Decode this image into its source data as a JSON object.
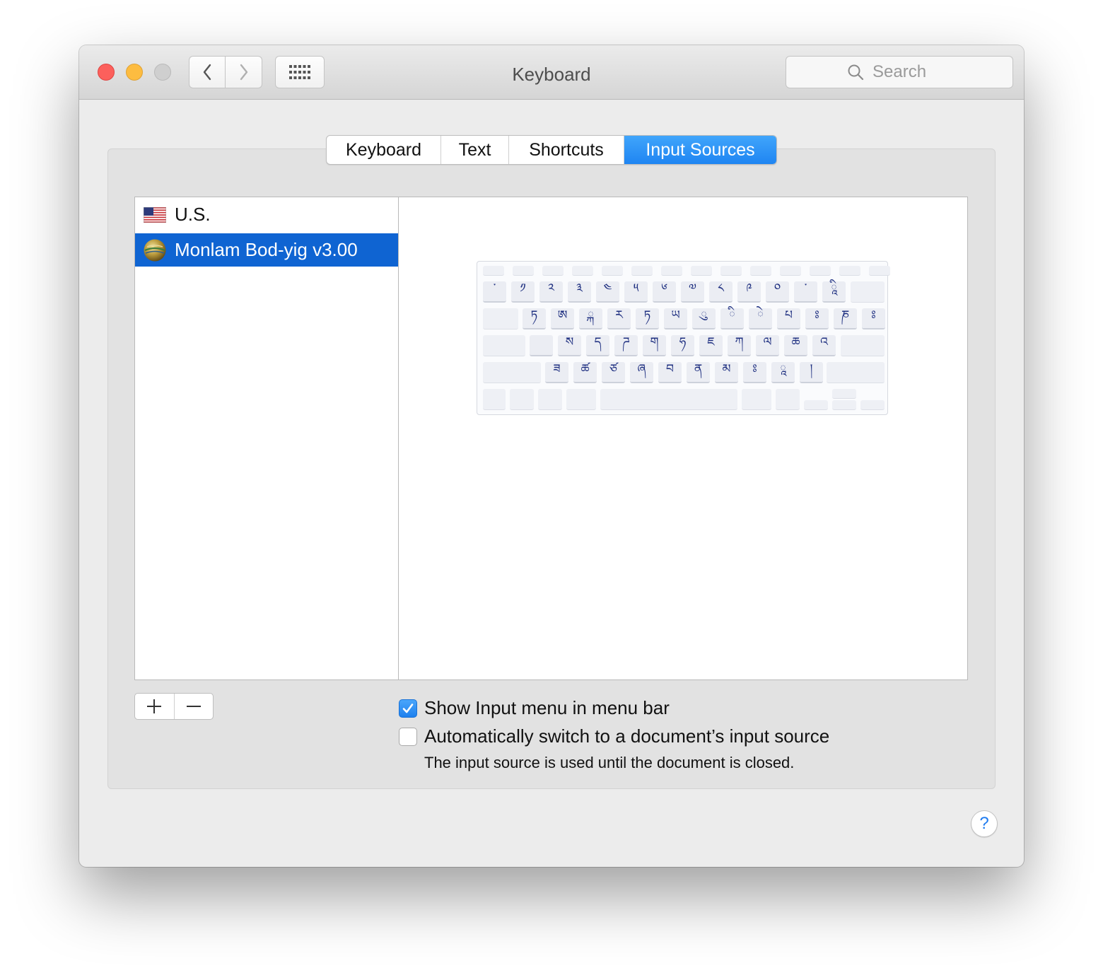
{
  "window": {
    "title": "Keyboard"
  },
  "search": {
    "placeholder": "Search"
  },
  "tabs": [
    {
      "label": "Keyboard",
      "active": false
    },
    {
      "label": "Text",
      "active": false
    },
    {
      "label": "Shortcuts",
      "active": false
    },
    {
      "label": "Input Sources",
      "active": true
    }
  ],
  "input_sources": [
    {
      "label": "U.S.",
      "icon": "us-flag-icon",
      "selected": false
    },
    {
      "label": "Monlam Bod-yig v3.00",
      "icon": "globe-icon",
      "selected": true
    }
  ],
  "keyboard_layout": {
    "row1": [
      "་",
      "༡",
      "༢",
      "༣",
      "༤",
      "༥",
      "༦",
      "༧",
      "༨",
      "༩",
      "༠",
      "༌",
      "ཱི"
    ],
    "row2": [
      "ཏ",
      "ཨ",
      "ྐ",
      "ར",
      "ཏ",
      "ཡ",
      "ུ",
      "ི",
      "ེ",
      "པ",
      "ཿ",
      "ཎ",
      "ཿ"
    ],
    "row3": [
      "ས",
      "ད",
      "ཌ",
      "ག",
      "ཧ",
      "ཇ",
      "ཀ",
      "ལ",
      "ཆ",
      "འ"
    ],
    "row4": [
      "ཟ",
      "ཚ",
      "ཙ",
      "ཞ",
      "བ",
      "ན",
      "མ",
      "ཿ",
      "ཱ",
      "།"
    ]
  },
  "controls": {
    "add_label": "+",
    "remove_label": "−",
    "show_input_menu": {
      "label": "Show Input menu in menu bar",
      "checked": true
    },
    "auto_switch": {
      "label": "Automatically switch to a document’s input source",
      "checked": false
    },
    "auto_switch_hint": "The input source is used until the document is closed.",
    "help_label": "?"
  },
  "colors": {
    "accent": "#1f85f2",
    "selection": "#0f64d2",
    "close": "#fc605c",
    "minimize": "#fdbc40",
    "zoom_disabled": "#cfcfcf",
    "key_glyph": "#1e2f80"
  }
}
